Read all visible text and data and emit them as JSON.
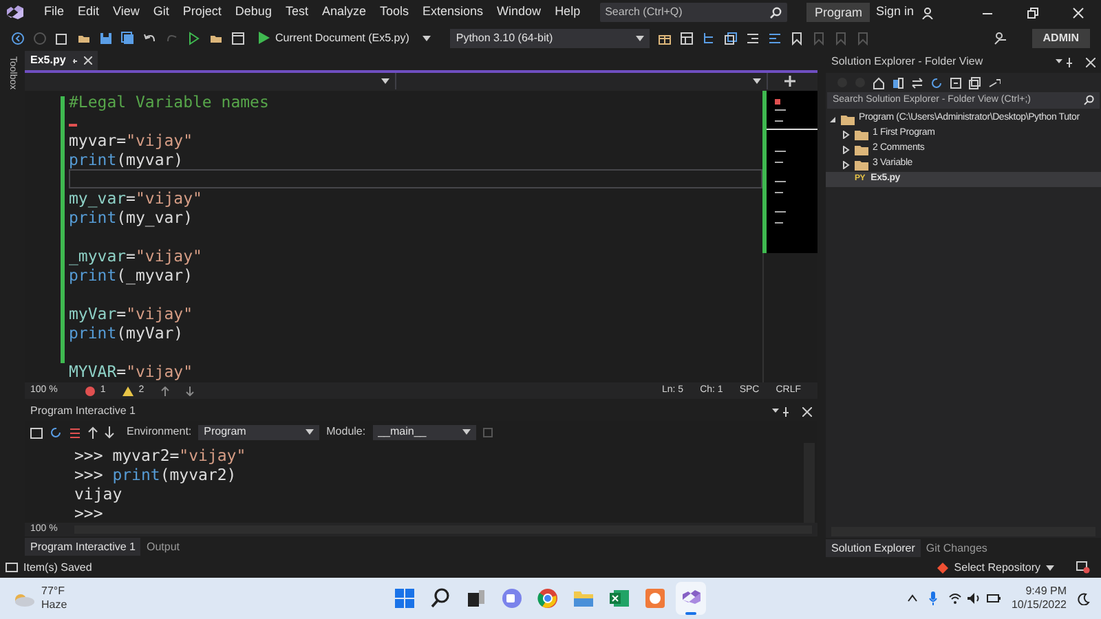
{
  "menu_bar": {
    "items": [
      {
        "label": "File"
      },
      {
        "label": "Edit"
      },
      {
        "label": "View"
      },
      {
        "label": "Git"
      },
      {
        "label": "Project"
      },
      {
        "label": "Debug"
      },
      {
        "label": "Test"
      },
      {
        "label": "Analyze"
      },
      {
        "label": "Tools"
      },
      {
        "label": "Extensions"
      },
      {
        "label": "Window"
      },
      {
        "label": "Help"
      }
    ],
    "search": {
      "placeholder": "Search (Ctrl+Q)"
    },
    "solution": "Program",
    "sign_in": "Sign in"
  },
  "toolbar": {
    "run_target": "Current Document (Ex5.py)",
    "environment": "Python 3.10 (64-bit)",
    "user": "ADMIN"
  },
  "toolbox": "Toolbox",
  "editor": {
    "tabs": [
      {
        "label": "Ex5.py",
        "selected": true
      }
    ],
    "lines": [
      {
        "current": false,
        "error_marker": false,
        "tokens": [
          {
            "text": "#Legal Variable names",
            "kind": "comment"
          }
        ]
      },
      {
        "current": false,
        "error_marker": true
      },
      {
        "current": false,
        "error_marker": false,
        "tokens": [
          {
            "text": "myvar",
            "kind": "name"
          },
          {
            "text": "=",
            "kind": "punct"
          },
          {
            "text": "\"vijay\"",
            "kind": "string"
          }
        ]
      },
      {
        "current": false,
        "error_marker": false,
        "tokens": [
          {
            "text": "print",
            "kind": "builtin"
          },
          {
            "text": "(myvar)",
            "kind": "punct"
          }
        ]
      },
      {
        "current": true,
        "error_marker": false
      },
      {
        "current": false,
        "error_marker": false,
        "tokens": [
          {
            "text": "my_var",
            "kind": "var"
          },
          {
            "text": "=",
            "kind": "punct"
          },
          {
            "text": "\"vijay\"",
            "kind": "string"
          }
        ]
      },
      {
        "current": false,
        "error_marker": false,
        "tokens": [
          {
            "text": "print",
            "kind": "builtin"
          },
          {
            "text": "(my_var)",
            "kind": "punct"
          }
        ]
      },
      {
        "current": false,
        "error_marker": false
      },
      {
        "current": false,
        "error_marker": false,
        "tokens": [
          {
            "text": "_myvar",
            "kind": "var"
          },
          {
            "text": "=",
            "kind": "punct"
          },
          {
            "text": "\"vijay\"",
            "kind": "string"
          }
        ]
      },
      {
        "current": false,
        "error_marker": false,
        "tokens": [
          {
            "text": "print",
            "kind": "builtin"
          },
          {
            "text": "(_myvar)",
            "kind": "punct"
          }
        ]
      },
      {
        "current": false,
        "error_marker": false
      },
      {
        "current": false,
        "error_marker": false,
        "tokens": [
          {
            "text": "myVar",
            "kind": "var"
          },
          {
            "text": "=",
            "kind": "punct"
          },
          {
            "text": "\"vijay\"",
            "kind": "string"
          }
        ]
      },
      {
        "current": false,
        "error_marker": false,
        "tokens": [
          {
            "text": "print",
            "kind": "builtin"
          },
          {
            "text": "(myVar)",
            "kind": "punct"
          }
        ]
      },
      {
        "current": false,
        "error_marker": false
      },
      {
        "current": false,
        "error_marker": false,
        "tokens": [
          {
            "text": "MYVAR",
            "kind": "var"
          },
          {
            "text": "=",
            "kind": "punct"
          },
          {
            "text": "\"vijay\"",
            "kind": "string"
          }
        ]
      }
    ],
    "status": {
      "zoom": "100 %",
      "errors": "1",
      "warnings": "2",
      "line": "Ln: 5",
      "column": "Ch: 1",
      "whitespace": "SPC",
      "line_ending": "CRLF"
    }
  },
  "interactive": {
    "title": "Program Interactive 1",
    "environment_label": "Environment:",
    "environment": "Program",
    "module_label": "Module:",
    "module": "__main__",
    "lines": [
      {
        "tokens": [
          {
            "text": ">>> ",
            "kind": "prompt"
          },
          {
            "text": "myvar2=",
            "kind": "punct"
          },
          {
            "text": "\"vijay\"",
            "kind": "string"
          }
        ]
      },
      {
        "tokens": [
          {
            "text": ">>> ",
            "kind": "prompt"
          },
          {
            "text": "print",
            "kind": "builtin"
          },
          {
            "text": "(myvar2)",
            "kind": "punct"
          }
        ]
      },
      {
        "tokens": [
          {
            "text": "vijay",
            "kind": "punct"
          }
        ]
      },
      {
        "tokens": [
          {
            "text": ">>>",
            "kind": "prompt"
          }
        ]
      }
    ],
    "zoom": "100 %"
  },
  "bottom_tabs": [
    {
      "label": "Program Interactive 1",
      "selected": true
    },
    {
      "label": "Output",
      "selected": false
    }
  ],
  "solution_explorer": {
    "title": "Solution Explorer - Folder View",
    "search": {
      "placeholder": "Search Solution Explorer - Folder View (Ctrl+;)"
    },
    "tree": [
      {
        "kind": "folder",
        "label": "Program (C:\\Users\\Administrator\\Desktop\\Python Tutor",
        "expanded": true,
        "selected": false,
        "children": [
          {
            "kind": "folder",
            "label": "1 First Program",
            "expanded": false,
            "selected": false
          },
          {
            "kind": "folder",
            "label": "2 Comments",
            "expanded": false,
            "selected": false
          },
          {
            "kind": "folder",
            "label": "3 Variable",
            "expanded": false,
            "selected": false
          },
          {
            "kind": "file",
            "label": "Ex5.py",
            "badge": "PY",
            "selected": true
          }
        ]
      }
    ],
    "tabs": [
      {
        "label": "Solution Explorer",
        "selected": true
      },
      {
        "label": "Git Changes",
        "selected": false
      }
    ]
  },
  "status_bar": {
    "message": "Item(s) Saved",
    "repository": "Select Repository"
  },
  "taskbar": {
    "weather": {
      "temperature": "77°F",
      "condition": "Haze"
    },
    "apps": [
      {
        "kind": "start",
        "active": false
      },
      {
        "kind": "search",
        "active": false
      },
      {
        "kind": "taskview",
        "active": false
      },
      {
        "kind": "chat",
        "active": false
      },
      {
        "kind": "browser",
        "active": false
      },
      {
        "kind": "files",
        "active": false
      },
      {
        "kind": "sheet",
        "active": false
      },
      {
        "kind": "recorder",
        "active": false
      },
      {
        "kind": "ide",
        "active": true
      }
    ],
    "time": "9:49 PM",
    "date": "10/15/2022"
  }
}
